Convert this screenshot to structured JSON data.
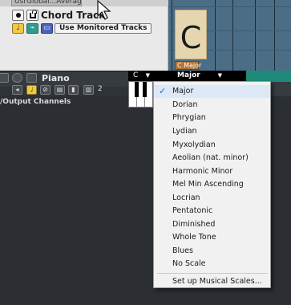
{
  "top": {
    "preset_label": "UsrGlobal...Average)",
    "chord_track_title": "Chord Track",
    "monitor_button_label": "Use Monitored Tracks"
  },
  "timeline": {
    "chord_letter": "C",
    "chord_event_label": "C Major"
  },
  "piano_track": {
    "title": "Piano",
    "channel_number": "2"
  },
  "io": {
    "label": "/Output Channels"
  },
  "selector": {
    "key_value": "C",
    "scale_value": "Major"
  },
  "dropdown": {
    "items": [
      {
        "label": "Major",
        "selected": true
      },
      {
        "label": "Dorian"
      },
      {
        "label": "Phrygian"
      },
      {
        "label": "Lydian"
      },
      {
        "label": "Myxolydian"
      },
      {
        "label": "Aeolian (nat. minor)"
      },
      {
        "label": "Harmonic Minor"
      },
      {
        "label": "Mel Min Ascending"
      },
      {
        "label": "Locrian"
      },
      {
        "label": "Pentatonic"
      },
      {
        "label": "Diminished"
      },
      {
        "label": "Whole Tone"
      },
      {
        "label": "Blues"
      },
      {
        "label": "No Scale"
      }
    ],
    "footer_item": "Set up Musical Scales..."
  },
  "colors": {
    "accent": "#2a6dc1",
    "timeline": "#4b6e86",
    "chord_block": "#e6d6b0",
    "chord_label": "#b37533",
    "teal_region": "#1f8a79"
  },
  "icons": [
    "record-icon",
    "lock-icon",
    "cursor-arrow-icon",
    "check-icon",
    "chevron-down-icon"
  ]
}
